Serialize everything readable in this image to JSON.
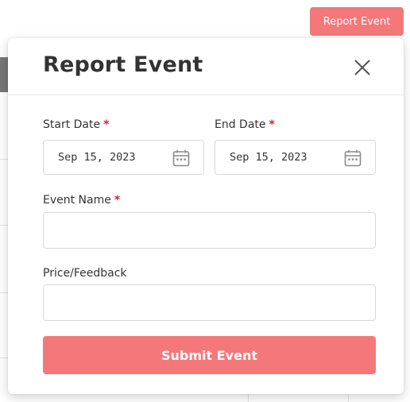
{
  "header": {
    "report_button_label": "Report Event"
  },
  "modal": {
    "title": "Report Event",
    "close_icon": "close-icon",
    "start_date": {
      "label": "Start Date",
      "required_mark": "*",
      "value": "Sep 15, 2023",
      "icon": "calendar-icon"
    },
    "end_date": {
      "label": "End Date",
      "required_mark": "*",
      "value": "Sep 15, 2023",
      "icon": "calendar-icon"
    },
    "event_name": {
      "label": "Event Name",
      "required_mark": "*",
      "value": "",
      "placeholder": ""
    },
    "price_feedback": {
      "label": "Price/Feedback",
      "value": "",
      "placeholder": ""
    },
    "submit_label": "Submit Event"
  },
  "colors": {
    "accent": "#f4787a",
    "required": "#d6202c"
  }
}
